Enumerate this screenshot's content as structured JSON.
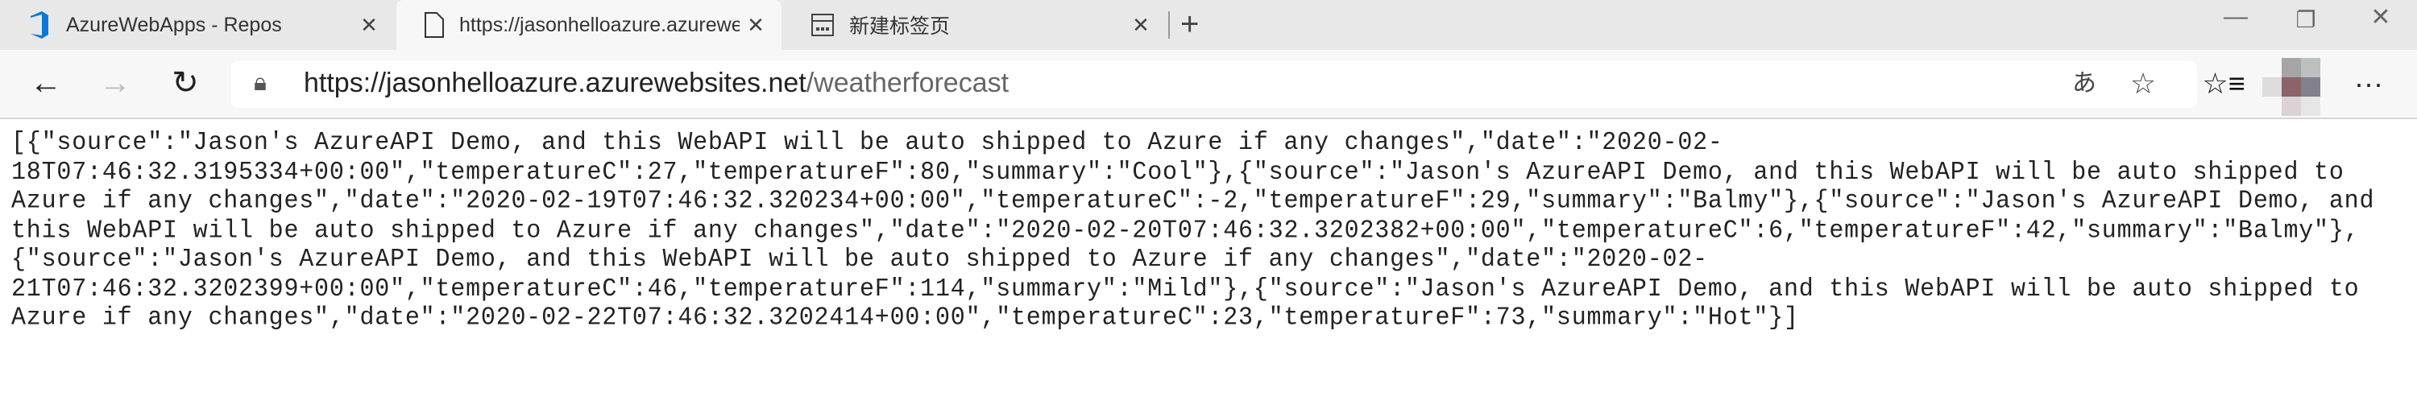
{
  "tabs": [
    {
      "title": "AzureWebApps - Repos",
      "icon": "azure-devops-icon",
      "active": false
    },
    {
      "title": "https://jasonhelloazure.azurewebsites.net/weatherforecast",
      "icon": "page-icon",
      "active": true
    },
    {
      "title": "新建标签页",
      "icon": "new-tab-page-icon",
      "active": false
    }
  ],
  "address_bar": {
    "host": "https://jasonhelloazure.azurewebsites.net",
    "path": "/weatherforecast"
  },
  "colors": {
    "tabbar": "#e8e8e8",
    "toolbar": "#f7f7f7",
    "azure_icon": "#0a78d4"
  },
  "body_text": "[{\"source\":\"Jason's AzureAPI Demo, and this WebAPI will be auto shipped to Azure if any changes\",\"date\":\"2020-02-18T07:46:32.3195334+00:00\",\"temperatureC\":27,\"temperatureF\":80,\"summary\":\"Cool\"},{\"source\":\"Jason's AzureAPI Demo, and this WebAPI will be auto shipped to Azure if any changes\",\"date\":\"2020-02-19T07:46:32.320234+00:00\",\"temperatureC\":-2,\"temperatureF\":29,\"summary\":\"Balmy\"},{\"source\":\"Jason's AzureAPI Demo, and this WebAPI will be auto shipped to Azure if any changes\",\"date\":\"2020-02-20T07:46:32.3202382+00:00\",\"temperatureC\":6,\"temperatureF\":42,\"summary\":\"Balmy\"},{\"source\":\"Jason's AzureAPI Demo, and this WebAPI will be auto shipped to Azure if any changes\",\"date\":\"2020-02-21T07:46:32.3202399+00:00\",\"temperatureC\":46,\"temperatureF\":114,\"summary\":\"Mild\"},{\"source\":\"Jason's AzureAPI Demo, and this WebAPI will be auto shipped to Azure if any changes\",\"date\":\"2020-02-22T07:46:32.3202414+00:00\",\"temperatureC\":23,\"temperatureF\":73,\"summary\":\"Hot\"}]"
}
